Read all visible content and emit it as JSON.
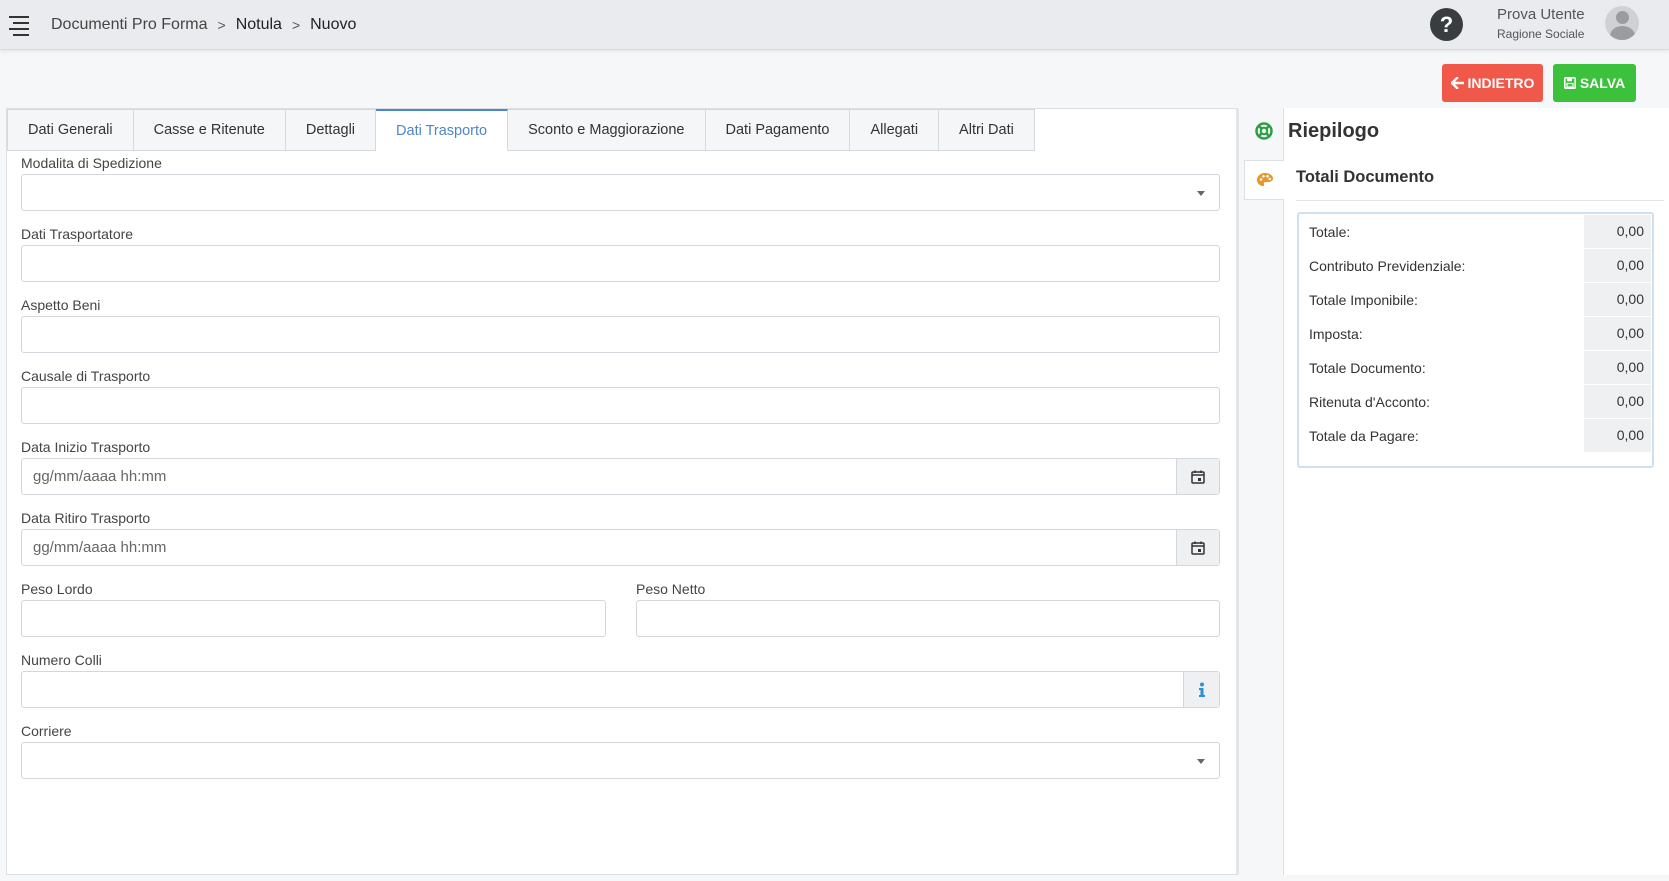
{
  "header": {
    "breadcrumb": [
      "Documenti Pro Forma",
      "Notula",
      "Nuovo"
    ],
    "breadcrumb_sep": ">",
    "help_label": "?",
    "user_name": "Prova Utente",
    "user_company": "Ragione Sociale"
  },
  "actions": {
    "back_label": "INDIETRO",
    "save_label": "SALVA",
    "back_color": "#f0584a",
    "save_color": "#3bc13b"
  },
  "tabs": [
    {
      "label": "Dati Generali",
      "active": false
    },
    {
      "label": "Casse e Ritenute",
      "active": false
    },
    {
      "label": "Dettagli",
      "active": false
    },
    {
      "label": "Dati Trasporto",
      "active": true
    },
    {
      "label": "Sconto e Maggiorazione",
      "active": false
    },
    {
      "label": "Dati Pagamento",
      "active": false
    },
    {
      "label": "Allegati",
      "active": false
    },
    {
      "label": "Altri Dati",
      "active": false
    }
  ],
  "form": {
    "modalita_spedizione": {
      "label": "Modalita di Spedizione",
      "value": ""
    },
    "dati_trasportatore": {
      "label": "Dati Trasportatore",
      "value": ""
    },
    "aspetto_beni": {
      "label": "Aspetto Beni",
      "value": ""
    },
    "causale_trasporto": {
      "label": "Causale di Trasporto",
      "value": ""
    },
    "data_inizio": {
      "label": "Data Inizio Trasporto",
      "placeholder": "gg/mm/aaaa hh:mm",
      "value": ""
    },
    "data_ritiro": {
      "label": "Data Ritiro Trasporto",
      "placeholder": "gg/mm/aaaa hh:mm",
      "value": ""
    },
    "peso_lordo": {
      "label": "Peso Lordo",
      "value": ""
    },
    "peso_netto": {
      "label": "Peso Netto",
      "value": ""
    },
    "numero_colli": {
      "label": "Numero Colli",
      "value": ""
    },
    "corriere": {
      "label": "Corriere",
      "value": ""
    }
  },
  "sidebar": {
    "title": "Riepilogo",
    "section_title": "Totali Documento",
    "totals": [
      {
        "label": "Totale:",
        "value": "0,00"
      },
      {
        "label": "Contributo Previdenziale:",
        "value": "0,00"
      },
      {
        "label": "Totale Imponibile:",
        "value": "0,00"
      },
      {
        "label": "Imposta:",
        "value": "0,00"
      },
      {
        "label": "Totale Documento:",
        "value": "0,00"
      },
      {
        "label": "Ritenuta d'Acconto:",
        "value": "0,00"
      },
      {
        "label": "Totale da Pagare:",
        "value": "0,00"
      }
    ]
  },
  "colors": {
    "accent_tab": "#4f86c6",
    "lifebuoy_icon": "#2e9e45",
    "palette_icon": "#e8952a",
    "info_icon": "#2f8fd6"
  }
}
